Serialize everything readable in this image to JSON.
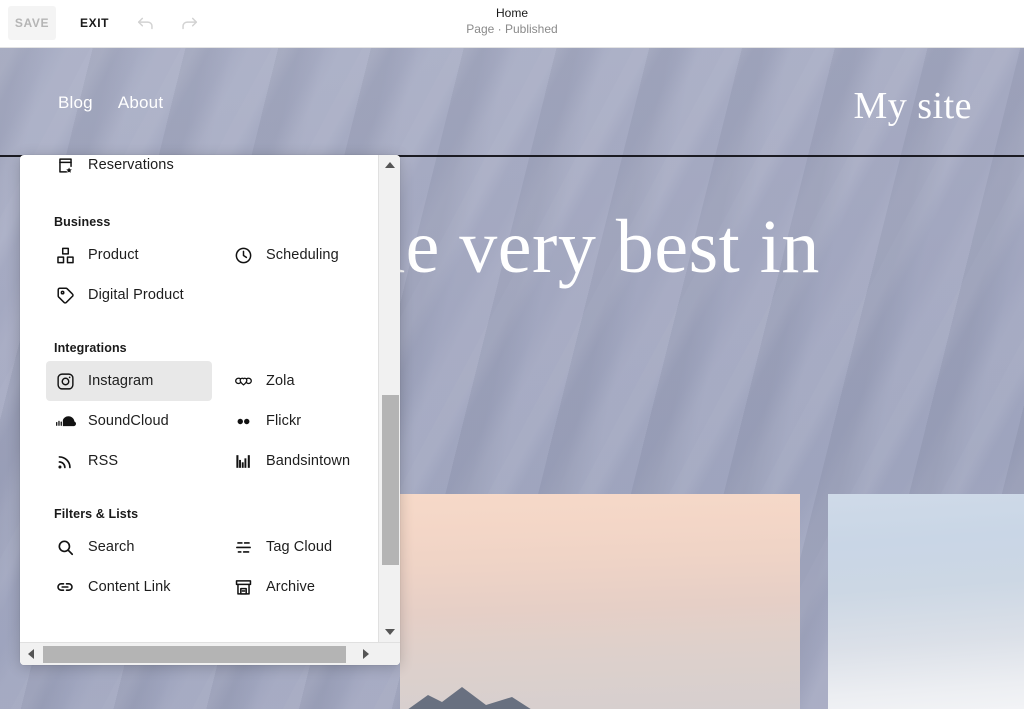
{
  "editor": {
    "save_label": "SAVE",
    "exit_label": "EXIT",
    "undo_icon": "undo-arrow-icon",
    "redo_icon": "redo-arrow-icon",
    "page_title": "Home",
    "page_status": "Page · Published"
  },
  "site": {
    "nav": [
      {
        "label": "Blog"
      },
      {
        "label": "About"
      }
    ],
    "brand": "My site",
    "hero_heading": "Curating the very best in\ntravel."
  },
  "picker": {
    "top_partial_item": {
      "label": "Reservations",
      "icon": "reservations-form-star-icon"
    },
    "groups": [
      {
        "title": "Business",
        "items": [
          {
            "label": "Product",
            "icon": "product-blocks-icon",
            "hovered": false
          },
          {
            "label": "Scheduling",
            "icon": "clock-icon",
            "hovered": false
          },
          {
            "label": "Digital Product",
            "icon": "price-tag-icon",
            "hovered": false
          }
        ]
      },
      {
        "title": "Integrations",
        "items": [
          {
            "label": "Instagram",
            "icon": "instagram-camera-icon",
            "hovered": true
          },
          {
            "label": "Zola",
            "icon": "zola-rings-icon",
            "hovered": false
          },
          {
            "label": "SoundCloud",
            "icon": "soundcloud-icon",
            "hovered": false
          },
          {
            "label": "Flickr",
            "icon": "flickr-dots-icon",
            "hovered": false
          },
          {
            "label": "RSS",
            "icon": "rss-feed-icon",
            "hovered": false
          },
          {
            "label": "Bandsintown",
            "icon": "bandsintown-icon",
            "hovered": false
          }
        ]
      },
      {
        "title": "Filters & Lists",
        "items": [
          {
            "label": "Search",
            "icon": "magnifier-icon",
            "hovered": false
          },
          {
            "label": "Tag Cloud",
            "icon": "tag-cloud-icon",
            "hovered": false
          },
          {
            "label": "Content Link",
            "icon": "chain-link-icon",
            "hovered": false
          },
          {
            "label": "Archive",
            "icon": "archive-box-icon",
            "hovered": false
          }
        ]
      }
    ],
    "scroll": {
      "v_up_icon": "scroll-up-arrow-icon",
      "v_down_icon": "scroll-down-arrow-icon",
      "h_left_icon": "scroll-left-arrow-icon",
      "h_right_icon": "scroll-right-arrow-icon"
    }
  },
  "colors": {
    "hero_background": "#a3a8c1",
    "panel_background": "#ffffff",
    "hover_row": "#e8e8e8",
    "scrollbar_track": "#f1f1f1",
    "scrollbar_thumb": "#b4b4b4",
    "text_primary": "#1a1a1a",
    "text_muted": "#8a8a8a",
    "save_disabled_text": "#b5b5b5"
  }
}
